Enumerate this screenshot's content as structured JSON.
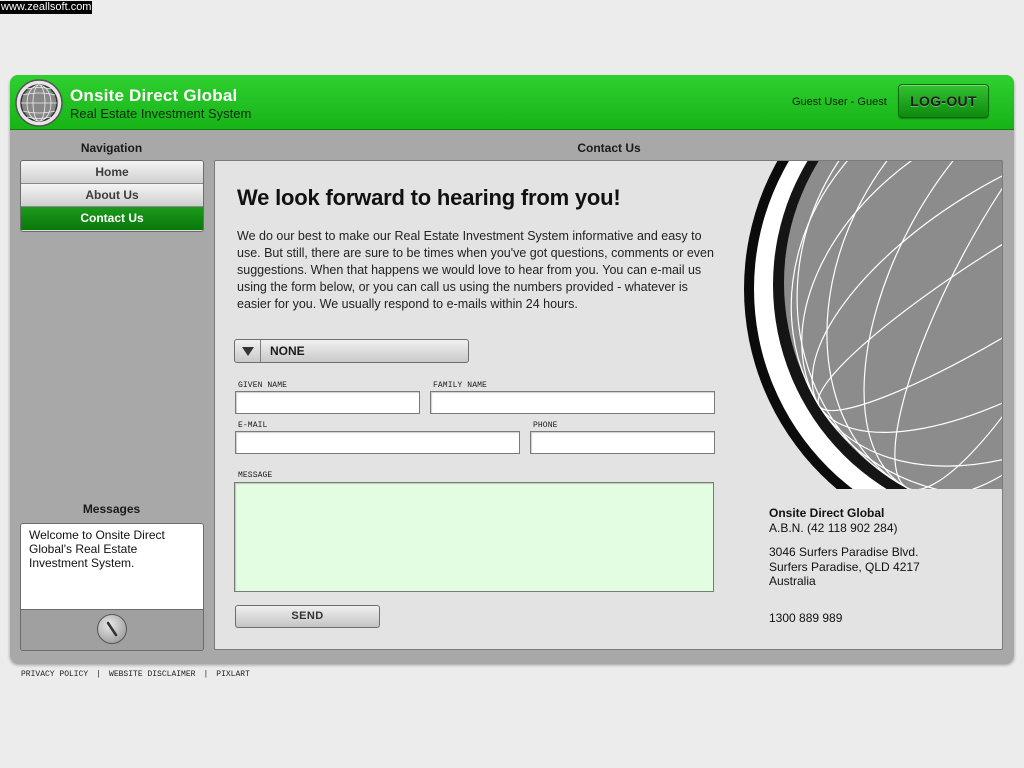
{
  "watermark": "www.zeallsoft.com",
  "header": {
    "title": "Onsite Direct Global",
    "subtitle": "Real Estate Investment System",
    "user": "Guest User - Guest",
    "logout_label": "LOG-OUT"
  },
  "navigation": {
    "heading": "Navigation",
    "items": [
      {
        "label": "Home",
        "active": false
      },
      {
        "label": "About Us",
        "active": false
      },
      {
        "label": "Contact Us",
        "active": true
      }
    ]
  },
  "messages": {
    "heading": "Messages",
    "text": "Welcome to Onsite Direct Global's Real Estate Investment System."
  },
  "content": {
    "heading": "Contact Us",
    "headline": "We look forward to hearing from you!",
    "intro": "We do our best to make our Real Estate Investment System informative and easy to use.  But still, there are sure to be times when you've got questions, comments or even suggestions.  When that happens we would love to hear from you.  You can e-mail us using the form below, or you can call us using the numbers provided - whatever is easier for you.  We usually respond to e-mails within 24 hours."
  },
  "form": {
    "topic_value": "NONE",
    "given_name_label": "GIVEN NAME",
    "family_name_label": "FAMILY NAME",
    "email_label": "E-MAIL",
    "phone_label": "PHONE",
    "message_label": "MESSAGE",
    "send_label": "SEND"
  },
  "company": {
    "name": "Onsite Direct Global",
    "abn": "A.B.N. (42 118 902 284)",
    "address1": "3046 Surfers Paradise Blvd.",
    "address2": "Surfers Paradise, QLD  4217",
    "country": "Australia",
    "phone": "1300 889 989"
  },
  "footer": {
    "privacy": "PRIVACY POLICY",
    "disclaimer": "WEBSITE DISCLAIMER",
    "pixlart": "PIXLART"
  },
  "colors": {
    "brand_green": "#1cbc1c",
    "nav_active": "#0f860f",
    "message_area": "#e3fde3"
  }
}
